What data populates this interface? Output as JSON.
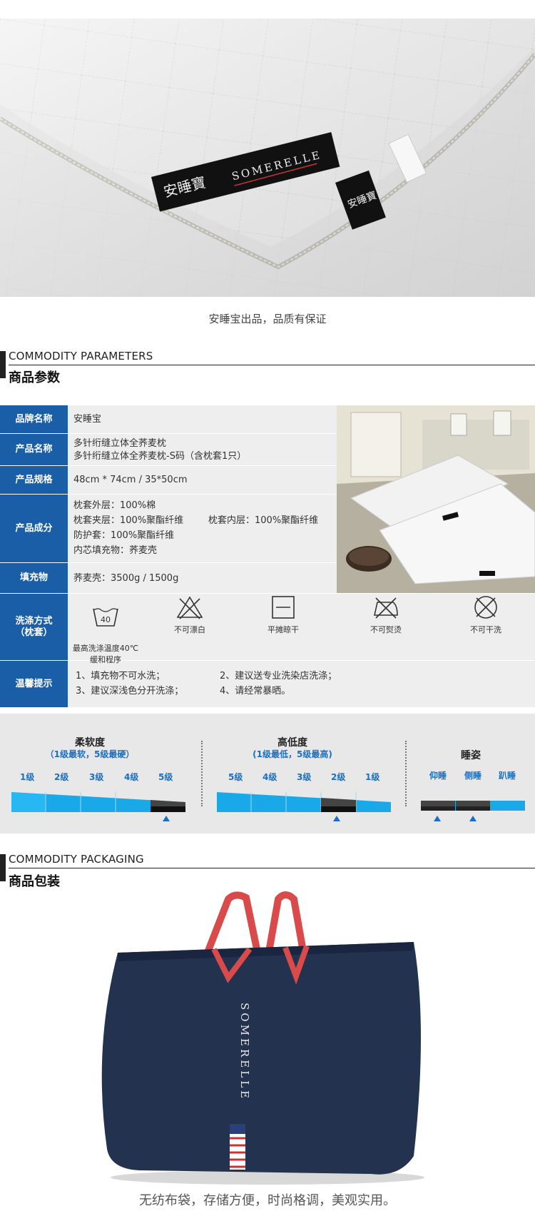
{
  "hero": {
    "label_brand": "SOMERELLE",
    "caption": "安睡宝出品，品质有保证"
  },
  "params_section": {
    "en_title": "COMMODITY PARAMETERS",
    "cn_title": "商品参数",
    "rows": [
      {
        "label": "品牌名称",
        "lines": [
          "安睡宝"
        ]
      },
      {
        "label": "产品名称",
        "lines": [
          "多针绗缝立体全荞麦枕",
          "多针绗缝立体全荞麦枕-S码（含枕套1只）"
        ]
      },
      {
        "label": "产品规格",
        "lines": [
          "48cm * 74cm / 35*50cm"
        ]
      },
      {
        "label": "产品成分",
        "lines": [
          "枕套外层：100%棉",
          "枕套夹层：100%聚酯纤维",
          "防护套：100%聚酯纤维",
          "内芯填充物：荞麦壳"
        ],
        "extra": "枕套内层：100%聚酯纤维"
      },
      {
        "label": "填充物",
        "lines": [
          "荞麦壳：3500g / 1500g"
        ]
      }
    ],
    "wash_label": "洗涤方式\n（枕套）",
    "wash_items": [
      {
        "icon": "wash-40-icon",
        "value": "40",
        "text": "最高洗涤温度40℃\n缓和程序"
      },
      {
        "icon": "no-bleach-icon",
        "text": "不可漂白"
      },
      {
        "icon": "dry-flat-icon",
        "text": "平摊晾干"
      },
      {
        "icon": "no-iron-icon",
        "text": "不可熨烫"
      },
      {
        "icon": "no-dryclean-icon",
        "text": "不可干洗"
      }
    ],
    "tips_label": "温馨提示",
    "tips": [
      "1、填充物不可水洗；",
      "2、建议送专业洗染店洗涤；",
      "3、建议深浅色分开洗涤；",
      "4、请经常暴晒。"
    ]
  },
  "scales": {
    "softness": {
      "title": "柔软度",
      "sub": "（1级最软，5级最硬）",
      "levels": [
        "1级",
        "2级",
        "3级",
        "4级",
        "5级"
      ],
      "selected": 5
    },
    "height": {
      "title": "高低度",
      "sub": "(1级最低，5级最高)",
      "levels": [
        "5级",
        "4级",
        "3级",
        "2级",
        "1级"
      ],
      "selected": 2
    },
    "posture": {
      "title": "睡姿",
      "levels": [
        "仰睡",
        "侧睡",
        "趴睡"
      ],
      "selected": [
        1,
        2
      ]
    }
  },
  "packaging_section": {
    "en_title": "COMMODITY PACKAGING",
    "cn_title": "商品包装",
    "bag_brand": "SOMERELLE",
    "caption": "无纺布袋，存储方便，时尚格调，美观实用。"
  },
  "colors": {
    "accent_blue": "#1b5ea8",
    "scale_blue": "#1aa9e8",
    "bag_navy": "#23324f",
    "handle_red": "#d94a4a"
  }
}
